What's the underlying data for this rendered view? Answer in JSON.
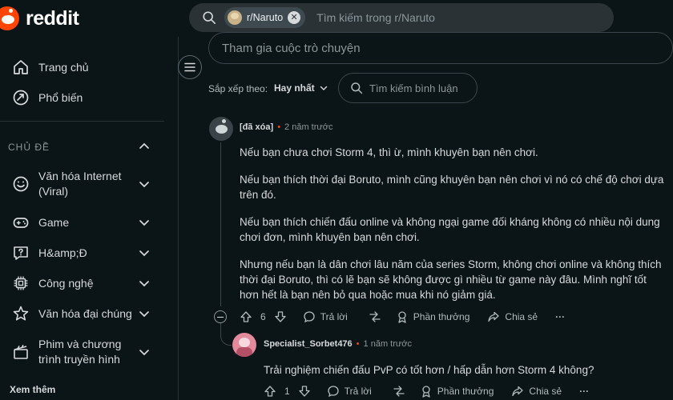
{
  "header": {
    "logo_text": "reddit",
    "search": {
      "chip_label": "r/Naruto",
      "chip_close": "✕",
      "placeholder": "Tìm kiếm trong r/Naruto"
    }
  },
  "sidebar": {
    "home": "Trang chủ",
    "popular": "Phổ biến",
    "topics_title": "CHỦ ĐỀ",
    "topics": [
      {
        "label_line1": "Văn hóa Internet",
        "label_line2": "(Viral)",
        "icon": "smile-icon"
      },
      {
        "label": "Game",
        "icon": "gamepad-icon"
      },
      {
        "label": "H&amp;Đ",
        "icon": "question-icon"
      },
      {
        "label": "Công nghệ",
        "icon": "chip-icon"
      },
      {
        "label": "Văn hóa đại chúng",
        "icon": "star-icon"
      },
      {
        "label_line1": "Phim và chương",
        "label_line2": "trình truyền hình",
        "icon": "clapperboard-icon"
      }
    ],
    "see_more": "Xem thêm"
  },
  "main": {
    "join_placeholder": "Tham gia cuộc trò chuyện",
    "sort_label": "Sắp xếp theo:",
    "sort_value": "Hay nhất",
    "comment_search_placeholder": "Tìm kiếm bình luận"
  },
  "comments": [
    {
      "author": "[đã xóa]",
      "time": "2 năm trước",
      "paragraphs": [
        "Nếu bạn chưa chơi Storm 4, thì ừ, mình khuyên bạn nên chơi.",
        "Nếu bạn thích thời đại Boruto, mình cũng khuyên bạn nên chơi vì nó có chế độ chơi dựa trên đó.",
        "Nếu bạn thích chiến đấu online và không ngại game đối kháng không có nhiều nội dung chơi đơn, mình khuyên bạn nên chơi.",
        "Nhưng nếu bạn là dân chơi lâu năm của series Storm, không chơi online và không thích thời đại Boruto, thì có lẽ bạn sẽ không được gì nhiều từ game này đâu. Mình nghĩ tốt hơn hết là bạn nên bỏ qua hoặc mua khi nó giảm giá."
      ],
      "votes": "6",
      "reply": "Trả lời",
      "award": "Phần thưởng",
      "share": "Chia sẻ",
      "more": "···"
    },
    {
      "author": "Specialist_Sorbet476",
      "time": "1 năm trước",
      "paragraphs": [
        "Trải nghiệm chiến đấu PvP có tốt hơn / hấp dẫn hơn Storm 4 không?"
      ],
      "votes": "1",
      "reply": "Trả lời",
      "award": "Phần thưởng",
      "share": "Chia sẻ",
      "more": "···"
    }
  ],
  "colors": {
    "background": "#0b1416",
    "brand": "#ff4500",
    "text": "#d7dadc",
    "muted": "#8b979b"
  }
}
